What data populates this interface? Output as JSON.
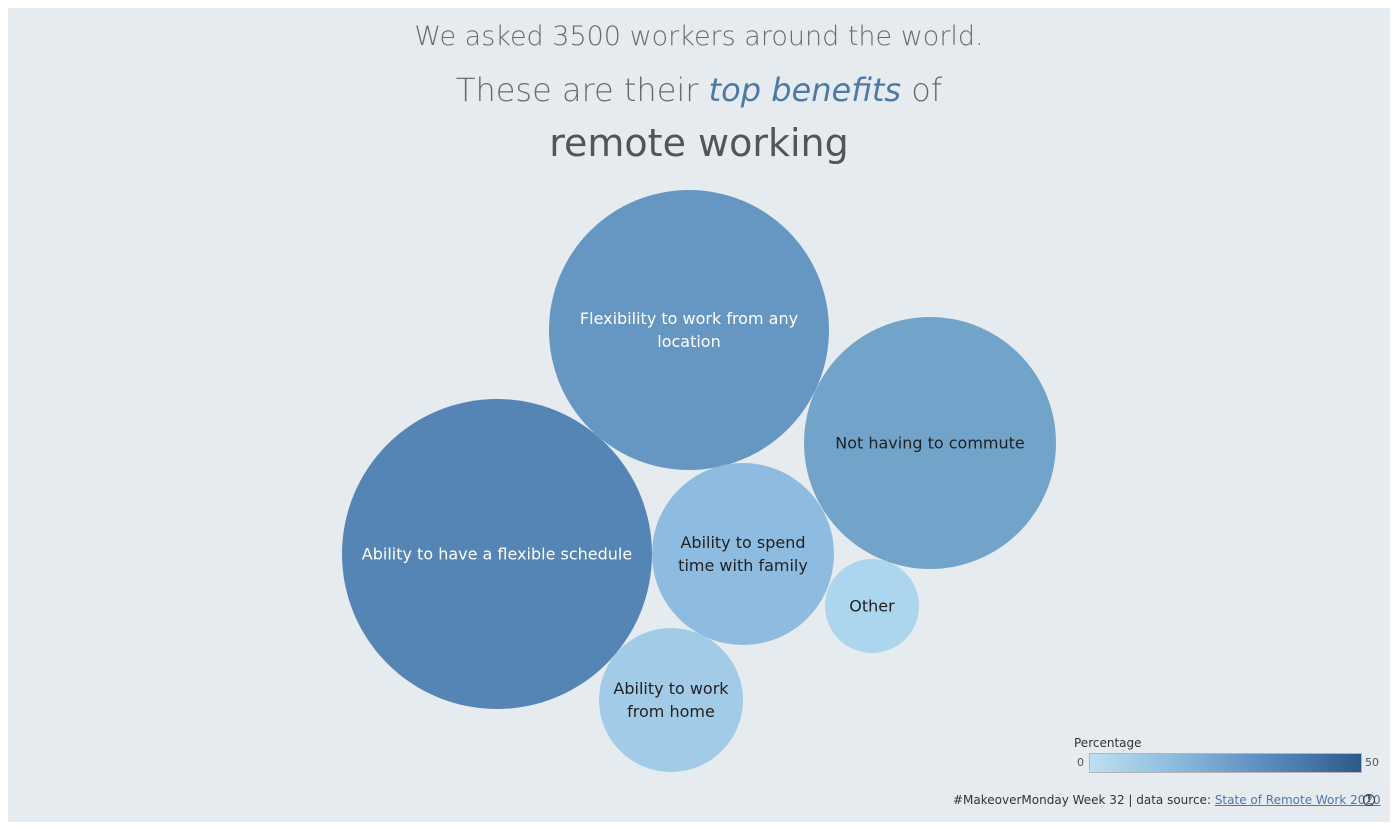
{
  "title": {
    "line1": "We asked 3500 workers around the world.",
    "line2_pre": "These are their",
    "line2_highlight": "top benefits",
    "line2_post": "of",
    "line3": "remote working"
  },
  "chart_data": {
    "type": "bubble",
    "items": [
      {
        "label": "Ability to have a flexible schedule",
        "value": 32,
        "color": "#5585b4",
        "text_color": "#ffffff"
      },
      {
        "label": "Flexibility to work from any location",
        "value": 26,
        "color": "#6697c2",
        "text_color": "#ffffff"
      },
      {
        "label": "Not having to commute",
        "value": 21,
        "color": "#72a4ca",
        "text_color": "#222222"
      },
      {
        "label": "Ability to spend time with family",
        "value": 11,
        "color": "#8ebce0",
        "text_color": "#222222"
      },
      {
        "label": "Ability to work from home",
        "value": 7,
        "color": "#a2cbe8",
        "text_color": "#222222"
      },
      {
        "label": "Other",
        "value": 3,
        "color": "#acd5ee",
        "text_color": "#222222"
      }
    ],
    "legend": {
      "title": "Percentage",
      "min": "0",
      "max": "50"
    }
  },
  "footer": {
    "text": "#MakeoverMonday Week 32 | data source:",
    "link": "State of Remote Work 2020"
  }
}
